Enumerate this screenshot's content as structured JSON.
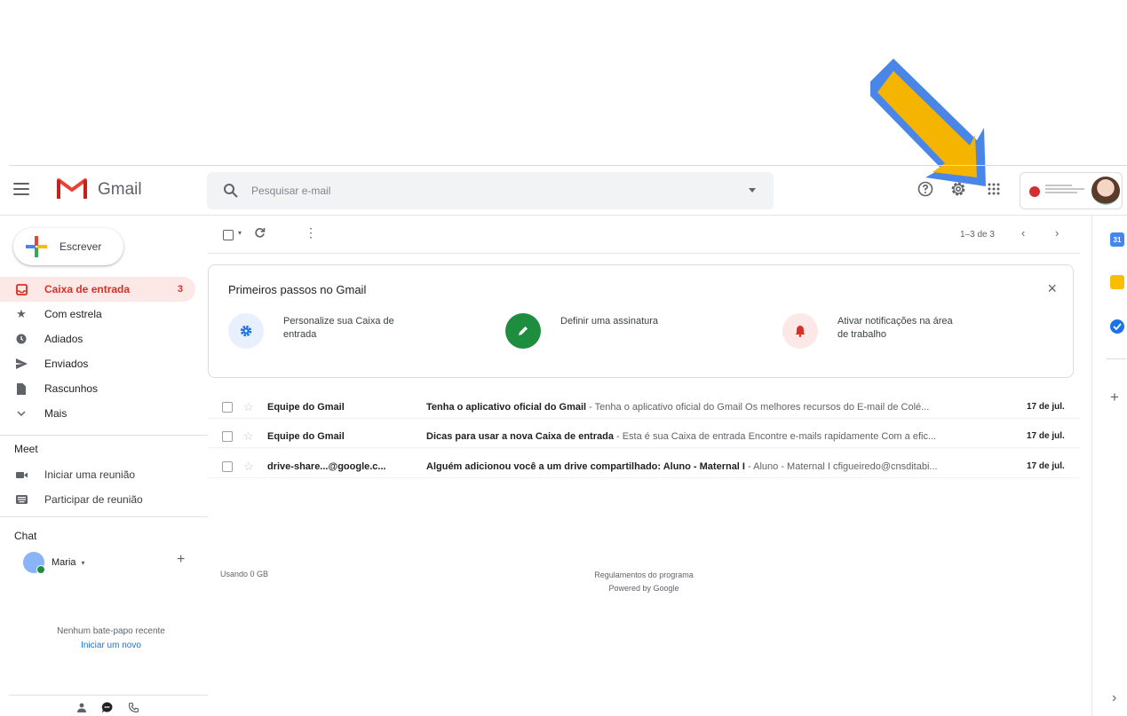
{
  "app": {
    "title": "Gmail"
  },
  "search": {
    "placeholder": "Pesquisar e-mail"
  },
  "compose": {
    "label": "Escrever"
  },
  "nav": [
    {
      "label": "Caixa de entrada",
      "count": "3",
      "icon": "inbox-icon",
      "active": true
    },
    {
      "label": "Com estrela",
      "icon": "star-icon"
    },
    {
      "label": "Adiados",
      "icon": "clock-icon"
    },
    {
      "label": "Enviados",
      "icon": "send-icon"
    },
    {
      "label": "Rascunhos",
      "icon": "draft-icon"
    },
    {
      "label": "Mais",
      "icon": "chevron-down-icon"
    }
  ],
  "meet": {
    "heading": "Meet",
    "items": [
      {
        "label": "Iniciar uma reunião",
        "icon": "video-icon"
      },
      {
        "label": "Participar de reunião",
        "icon": "keyboard-icon"
      }
    ]
  },
  "chat": {
    "heading": "Chat",
    "user": "Maria",
    "empty_text": "Nenhum bate-papo recente",
    "start_link": "Iniciar um novo"
  },
  "toolbar": {
    "pager": "1–3 de 3"
  },
  "onboarding": {
    "title": "Primeiros passos no Gmail",
    "tasks": [
      {
        "text": "Personalize sua Caixa de entrada",
        "icon": "gear-icon",
        "color": "#1a73e8",
        "bg": "#e8f0fe"
      },
      {
        "text": "Definir uma assinatura",
        "icon": "pen-icon",
        "color": "#ffffff",
        "bg": "#1e8e3e"
      },
      {
        "text": "Ativar notificações na área de trabalho",
        "icon": "bell-icon",
        "color": "#d93025",
        "bg": "#fce8e6"
      }
    ]
  },
  "emails": [
    {
      "sender": "Equipe do Gmail",
      "subject": "Tenha o aplicativo oficial do Gmail",
      "snippet": " - Tenha o aplicativo oficial do Gmail Os melhores recursos do E-mail de Colé...",
      "date": "17 de jul."
    },
    {
      "sender": "Equipe do Gmail",
      "subject": "Dicas para usar a nova Caixa de entrada",
      "snippet": " - Esta é sua Caixa de entrada Encontre e-mails rapidamente Com a efic...",
      "date": "17 de jul."
    },
    {
      "sender": "drive-share...@google.c...",
      "subject": "Alguém adicionou você a um drive compartilhado: Aluno - Maternal I",
      "snippet": " - Aluno - Maternal I cfigueiredo@cnsditabi...",
      "date": "17 de jul."
    }
  ],
  "footer": {
    "storage": "Usando 0 GB",
    "policy": "Regulamentos do programa",
    "powered": "Powered by Google"
  },
  "rail": {
    "calendar_day": "31"
  },
  "colors": {
    "accent_red": "#d93025",
    "arrow_yellow": "#f4b400",
    "arrow_blue": "#4285f4"
  }
}
